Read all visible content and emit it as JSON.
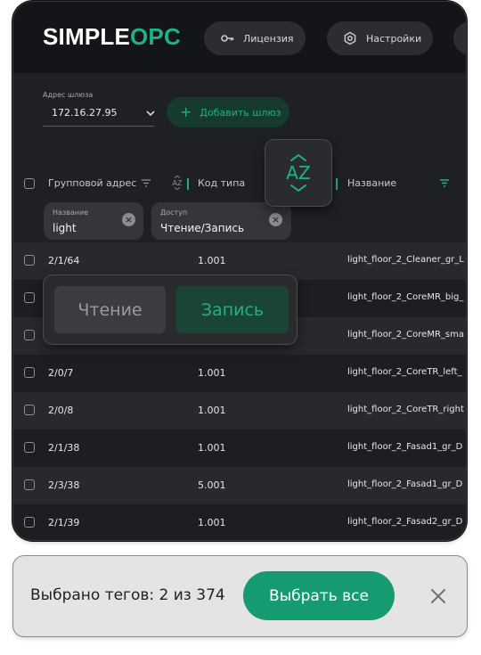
{
  "app": {
    "logo_main": "SIMPLE",
    "logo_accent": "OPC",
    "nav": [
      {
        "label": "Лицензия",
        "icon": "key-icon"
      },
      {
        "label": "Настройки",
        "icon": "settings-icon"
      }
    ]
  },
  "gateway": {
    "label": "Адрес шлюза",
    "value": "172.16.27.95",
    "add_button_label": "Добавить шлюз"
  },
  "table": {
    "headers": {
      "group_address": "Групповой адрес",
      "type_code": "Код типа",
      "name": "Название"
    },
    "filters": [
      {
        "label": "Название",
        "value": "light"
      },
      {
        "label": "Доступ",
        "value": "Чтение/Запись"
      }
    ],
    "rows": [
      {
        "address": "2/1/64",
        "type": "1.001",
        "name": "light_floor_2_Cleaner_gr_L"
      },
      {
        "address": "",
        "type": "",
        "name": "light_floor_2_CoreMR_big_"
      },
      {
        "address": "",
        "type": "",
        "name": "light_floor_2_CoreMR_sma"
      },
      {
        "address": "2/0/7",
        "type": "1.001",
        "name": "light_floor_2_CoreTR_left_"
      },
      {
        "address": "2/0/8",
        "type": "1.001",
        "name": "light_floor_2_CoreTR_right"
      },
      {
        "address": "2/1/38",
        "type": "1.001",
        "name": "light_floor_2_Fasad1_gr_D"
      },
      {
        "address": "2/3/38",
        "type": "5.001",
        "name": "light_floor_2_Fasad1_gr_D"
      },
      {
        "address": "2/1/39",
        "type": "1.001",
        "name": "light_floor_2_Fasad2_gr_D"
      }
    ]
  },
  "sort_popup": {
    "label": "AZ"
  },
  "access_popup": {
    "read_label": "Чтение",
    "write_label": "Запись",
    "selected": "Запись"
  },
  "toast": {
    "text": "Выбрано тегов: 2 из 374",
    "select_all_label": "Выбрать все"
  },
  "colors": {
    "accent": "#1fb184",
    "background": "#1f2023",
    "toast_button": "#169a72"
  }
}
